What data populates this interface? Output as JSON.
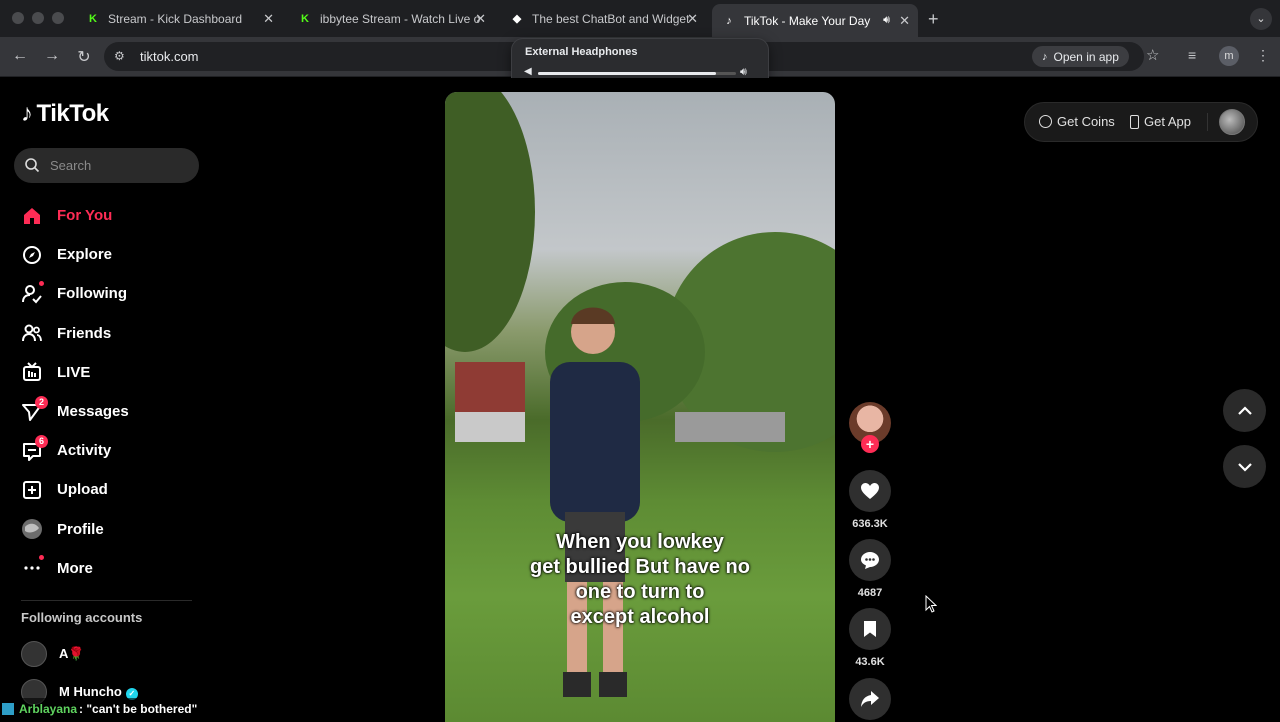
{
  "browser": {
    "tabs": [
      {
        "title": "Stream - Kick Dashboard",
        "favicon": "K"
      },
      {
        "title": "ibbytee Stream - Watch Live o",
        "favicon": "K"
      },
      {
        "title": "The best ChatBot and Widget",
        "favicon": "◆"
      },
      {
        "title": "TikTok - Make Your Day",
        "favicon": "♪"
      }
    ],
    "url": "tiktok.com",
    "open_in_app": "Open in app",
    "profile_initial": "m"
  },
  "volume_popup": {
    "device": "External Headphones",
    "level": 0.9
  },
  "tiktok": {
    "logo_text": "TikTok",
    "search_placeholder": "Search",
    "nav": [
      {
        "label": "For You",
        "icon": "home-icon"
      },
      {
        "label": "Explore",
        "icon": "compass-icon"
      },
      {
        "label": "Following",
        "icon": "following-icon"
      },
      {
        "label": "Friends",
        "icon": "friends-icon"
      },
      {
        "label": "LIVE",
        "icon": "live-icon"
      },
      {
        "label": "Messages",
        "icon": "messages-icon",
        "badge": "2"
      },
      {
        "label": "Activity",
        "icon": "activity-icon",
        "badge": "6"
      },
      {
        "label": "Upload",
        "icon": "upload-icon"
      },
      {
        "label": "Profile",
        "icon": "profile-icon"
      },
      {
        "label": "More",
        "icon": "more-icon"
      }
    ],
    "following_title": "Following accounts",
    "accounts": [
      {
        "name": "A🌹"
      },
      {
        "name": "M Huncho"
      }
    ],
    "get_coins": "Get Coins",
    "get_app": "Get App",
    "video": {
      "caption_lines": [
        "When you lowkey",
        "get bullied But have no",
        "one to turn to",
        "except alcohol"
      ]
    },
    "stats": {
      "likes": "636.3K",
      "comments": "4687",
      "saves": "43.6K"
    }
  },
  "chat_overlay": {
    "user": "Arblayana",
    "message": ": \"can't be bothered\""
  }
}
